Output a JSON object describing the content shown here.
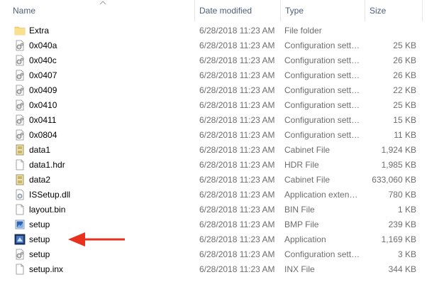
{
  "columns": {
    "name": "Name",
    "date": "Date modified",
    "type": "Type",
    "size": "Size"
  },
  "files": [
    {
      "name": "Extra",
      "date": "6/28/2018 11:23 AM",
      "type": "File folder",
      "size": "",
      "icon": "folder-icon"
    },
    {
      "name": "0x040a",
      "date": "6/28/2018 11:23 AM",
      "type": "Configuration settings",
      "size": "25 KB",
      "icon": "config-file-icon"
    },
    {
      "name": "0x040c",
      "date": "6/28/2018 11:23 AM",
      "type": "Configuration settings",
      "size": "26 KB",
      "icon": "config-file-icon"
    },
    {
      "name": "0x0407",
      "date": "6/28/2018 11:23 AM",
      "type": "Configuration settings",
      "size": "26 KB",
      "icon": "config-file-icon"
    },
    {
      "name": "0x0409",
      "date": "6/28/2018 11:23 AM",
      "type": "Configuration settings",
      "size": "22 KB",
      "icon": "config-file-icon"
    },
    {
      "name": "0x0410",
      "date": "6/28/2018 11:23 AM",
      "type": "Configuration settings",
      "size": "25 KB",
      "icon": "config-file-icon"
    },
    {
      "name": "0x0411",
      "date": "6/28/2018 11:23 AM",
      "type": "Configuration settings",
      "size": "15 KB",
      "icon": "config-file-icon"
    },
    {
      "name": "0x0804",
      "date": "6/28/2018 11:23 AM",
      "type": "Configuration settings",
      "size": "11 KB",
      "icon": "config-file-icon"
    },
    {
      "name": "data1",
      "date": "6/28/2018 11:23 AM",
      "type": "Cabinet File",
      "size": "1,924 KB",
      "icon": "cabinet-file-icon"
    },
    {
      "name": "data1.hdr",
      "date": "6/28/2018 11:23 AM",
      "type": "HDR File",
      "size": "1,985 KB",
      "icon": "generic-file-icon"
    },
    {
      "name": "data2",
      "date": "6/28/2018 11:23 AM",
      "type": "Cabinet File",
      "size": "633,060 KB",
      "icon": "cabinet-file-icon"
    },
    {
      "name": "ISSetup.dll",
      "date": "6/28/2018 11:23 AM",
      "type": "Application extension",
      "size": "780 KB",
      "icon": "dll-file-icon"
    },
    {
      "name": "layout.bin",
      "date": "6/28/2018 11:23 AM",
      "type": "BIN File",
      "size": "1 KB",
      "icon": "generic-file-icon"
    },
    {
      "name": "setup",
      "date": "6/28/2018 11:23 AM",
      "type": "BMP File",
      "size": "239 KB",
      "icon": "bmp-file-icon"
    },
    {
      "name": "setup",
      "date": "6/28/2018 11:23 AM",
      "type": "Application",
      "size": "1,169 KB",
      "icon": "setup-app-icon"
    },
    {
      "name": "setup",
      "date": "6/28/2018 11:23 AM",
      "type": "Configuration settings",
      "size": "3 KB",
      "icon": "config-file-icon"
    },
    {
      "name": "setup.inx",
      "date": "6/28/2018 11:23 AM",
      "type": "INX File",
      "size": "344 KB",
      "icon": "generic-file-icon"
    }
  ],
  "colors": {
    "header_text": "#4c607a",
    "detail_text": "#6d6d6d",
    "arrow": "#e8321e",
    "folder": "#f8d775"
  }
}
